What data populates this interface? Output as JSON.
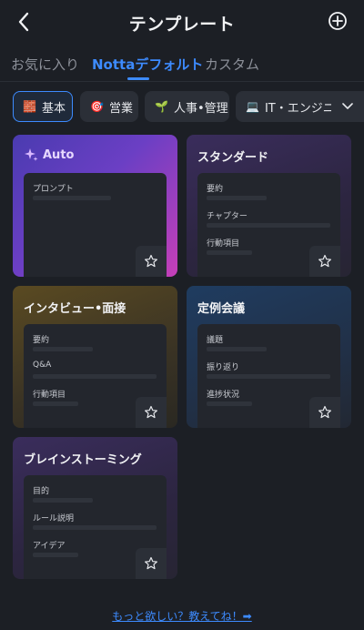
{
  "header": {
    "title": "テンプレート"
  },
  "tabs": [
    {
      "label": "お気に入り",
      "active": false
    },
    {
      "label": "Nottaデフォルト",
      "active": true
    },
    {
      "label": "カスタム",
      "active": false
    }
  ],
  "chips": [
    {
      "emoji": "🧱",
      "label": "基本",
      "active": true
    },
    {
      "emoji": "🎯",
      "label": "営業",
      "active": false
    },
    {
      "emoji": "🌱",
      "label": "人事•管理",
      "active": false
    },
    {
      "emoji": "💻",
      "label": "IT・エンジニア",
      "active": false
    }
  ],
  "cards": [
    {
      "title": "Auto",
      "fields": [
        "プロンプト"
      ]
    },
    {
      "title": "スタンダード",
      "fields": [
        "要約",
        "チャプター",
        "行動項目"
      ]
    },
    {
      "title": "インタビュー•面接",
      "fields": [
        "要約",
        "Q&A",
        "行動項目"
      ]
    },
    {
      "title": "定例会議",
      "fields": [
        "議題",
        "振り返り",
        "進捗状況"
      ]
    },
    {
      "title": "ブレインストーミング",
      "fields": [
        "目的",
        "ルール説明",
        "アイデア"
      ]
    }
  ],
  "footer": {
    "link_text": "もっと欲しい？教えてね！➡"
  },
  "colors": {
    "accent": "#3d8bff",
    "background": "#1c1f25"
  }
}
